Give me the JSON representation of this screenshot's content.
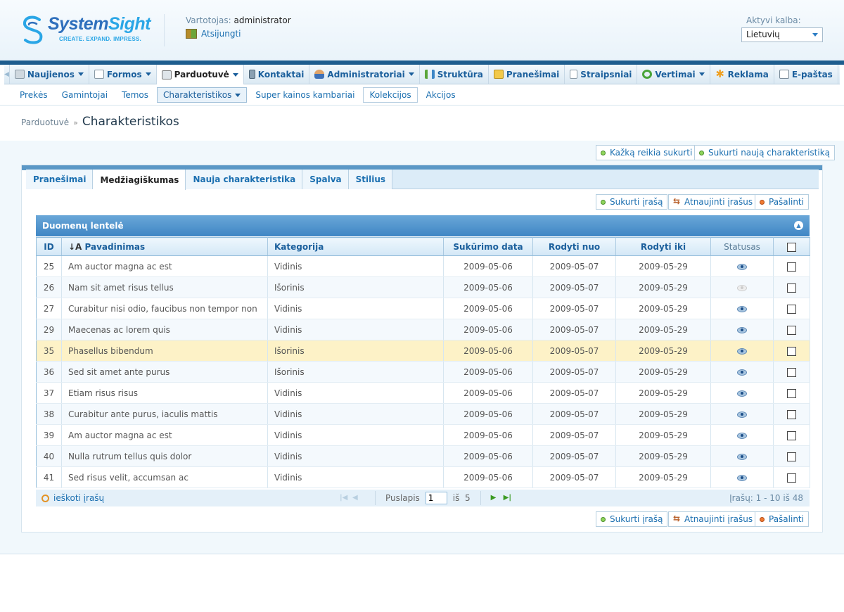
{
  "header": {
    "logo_system": "System",
    "logo_sight": "Sight",
    "logo_tagline": "CREATE. EXPAND. IMPRESS.",
    "user_label": "Vartotojas:",
    "user_name": "administrator",
    "logout_label": "Atsijungti",
    "lang_label": "Aktyvi kalba:",
    "lang_value": "Lietuvių"
  },
  "menu": {
    "items": [
      {
        "label": "Naujienos",
        "icon": "news-icon",
        "dropdown": true
      },
      {
        "label": "Formos",
        "icon": "forms-icon",
        "dropdown": true
      },
      {
        "label": "Parduotuvė",
        "icon": "cart-icon",
        "dropdown": true
      },
      {
        "label": "Kontaktai",
        "icon": "phone-icon",
        "dropdown": false
      },
      {
        "label": "Administratoriai",
        "icon": "user-icon",
        "dropdown": true
      },
      {
        "label": "Struktūra",
        "icon": "structure-icon",
        "dropdown": false
      },
      {
        "label": "Pranešimai",
        "icon": "message-icon",
        "dropdown": false
      },
      {
        "label": "Straipsniai",
        "icon": "document-icon",
        "dropdown": false
      },
      {
        "label": "Vertimai",
        "icon": "refresh-icon",
        "dropdown": true
      },
      {
        "label": "Reklama",
        "icon": "star-icon",
        "dropdown": false
      },
      {
        "label": "E-paštas",
        "icon": "mail-icon",
        "dropdown": false
      }
    ]
  },
  "submenu": {
    "items": [
      "Prekės",
      "Gamintojai",
      "Temos",
      "Charakteristikos",
      "Super kainos kambariai",
      "Kolekcijos",
      "Akcijos"
    ]
  },
  "breadcrumb": {
    "parent": "Parduotuvė",
    "current": "Charakteristikos"
  },
  "top_actions": {
    "create_something": "Kažką reikia sukurti",
    "create_characteristic": "Sukurti naują charakteristiką"
  },
  "tabs": [
    "Pranešimai",
    "Medžiagiškumas",
    "Nauja charakteristika",
    "Spalva",
    "Stilius"
  ],
  "actions": {
    "create": "Sukurti įrašą",
    "refresh": "Atnaujinti įrašus",
    "delete": "Pašalinti"
  },
  "grid": {
    "title": "Duomenų lentelė",
    "columns": {
      "id": "ID",
      "name": "Pavadinimas",
      "name_sort": "↓A",
      "category": "Kategorija",
      "created": "Sukūrimo data",
      "show_from": "Rodyti nuo",
      "show_to": "Rodyti iki",
      "status": "Statusas"
    },
    "rows": [
      {
        "id": "25",
        "name": "Am auctor magna ac est",
        "category": "Vidinis",
        "created": "2009-05-06",
        "from": "2009-05-07",
        "to": "2009-05-29",
        "visible": true
      },
      {
        "id": "26",
        "name": "Nam sit amet risus tellus",
        "category": "Išorinis",
        "created": "2009-05-06",
        "from": "2009-05-07",
        "to": "2009-05-29",
        "visible": false
      },
      {
        "id": "27",
        "name": "Curabitur nisi odio, faucibus non tempor non",
        "category": "Vidinis",
        "created": "2009-05-06",
        "from": "2009-05-07",
        "to": "2009-05-29",
        "visible": true
      },
      {
        "id": "29",
        "name": "Maecenas ac lorem quis",
        "category": "Vidinis",
        "created": "2009-05-06",
        "from": "2009-05-07",
        "to": "2009-05-29",
        "visible": true
      },
      {
        "id": "35",
        "name": "Phasellus bibendum",
        "category": "Išorinis",
        "created": "2009-05-06",
        "from": "2009-05-07",
        "to": "2009-05-29",
        "visible": true
      },
      {
        "id": "36",
        "name": "Sed sit amet ante purus",
        "category": "Išorinis",
        "created": "2009-05-06",
        "from": "2009-05-07",
        "to": "2009-05-29",
        "visible": true
      },
      {
        "id": "37",
        "name": "Etiam risus risus",
        "category": "Vidinis",
        "created": "2009-05-06",
        "from": "2009-05-07",
        "to": "2009-05-29",
        "visible": true
      },
      {
        "id": "38",
        "name": "Curabitur ante purus, iaculis mattis",
        "category": "Vidinis",
        "created": "2009-05-06",
        "from": "2009-05-07",
        "to": "2009-05-29",
        "visible": true
      },
      {
        "id": "39",
        "name": "Am auctor magna ac est",
        "category": "Vidinis",
        "created": "2009-05-06",
        "from": "2009-05-07",
        "to": "2009-05-29",
        "visible": true
      },
      {
        "id": "40",
        "name": "Nulla rutrum tellus quis dolor",
        "category": "Vidinis",
        "created": "2009-05-06",
        "from": "2009-05-07",
        "to": "2009-05-29",
        "visible": true
      },
      {
        "id": "41",
        "name": "Sed risus velit, accumsan ac",
        "category": "Vidinis",
        "created": "2009-05-06",
        "from": "2009-05-07",
        "to": "2009-05-29",
        "visible": true
      }
    ]
  },
  "pager": {
    "search_label": "ieškoti įrašų",
    "page_label": "Puslapis",
    "page_value": "1",
    "of_label": "iš",
    "total_pages": "5",
    "records_info": "Įrašų: 1 - 10  iš 48"
  }
}
